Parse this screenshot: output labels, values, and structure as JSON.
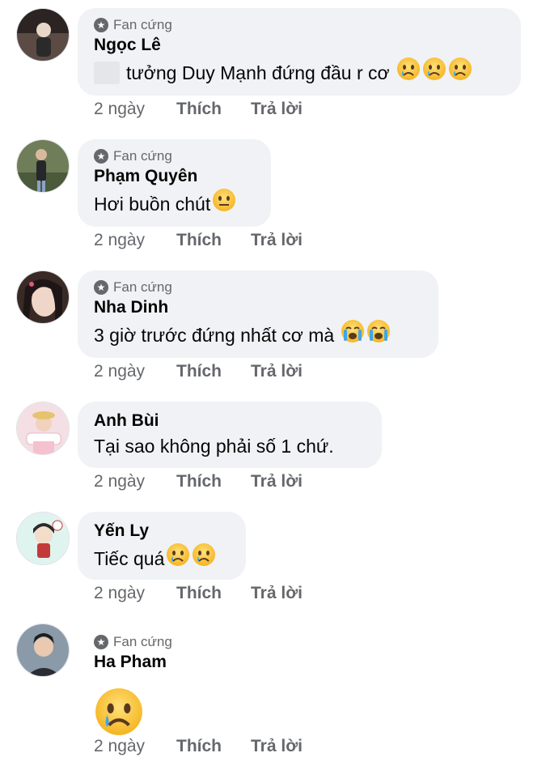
{
  "actions": {
    "time": "2 ngày",
    "like": "Thích",
    "reply": "Trả lời"
  },
  "badge_label": "Fan cứng",
  "comments": [
    {
      "name": "Ngọc Lê",
      "text": "tưởng Duy Mạnh đứng đầu r cơ",
      "badge": true,
      "emoji": [
        "sad",
        "sad",
        "sad"
      ]
    },
    {
      "name": "Phạm Quyên",
      "text": "Hơi buồn chút",
      "badge": true,
      "emoji": [
        "neutral"
      ]
    },
    {
      "name": "Nha Dinh",
      "text": "3 giờ trước đứng nhất cơ mà",
      "badge": true,
      "emoji": [
        "cry",
        "cry"
      ]
    },
    {
      "name": "Anh Bùi",
      "text": "Tại sao không phải số 1 chứ.",
      "badge": false,
      "emoji": []
    },
    {
      "name": "Yến Ly",
      "text": "Tiếc quá",
      "badge": false,
      "emoji": [
        "sad",
        "sad"
      ]
    },
    {
      "name": "Ha Pham",
      "text": "",
      "badge": true,
      "emoji": [
        "sad-large"
      ]
    }
  ],
  "colors": {
    "bubble": "#f0f2f5",
    "muted": "#65676b",
    "emoji": "#f7c737"
  }
}
